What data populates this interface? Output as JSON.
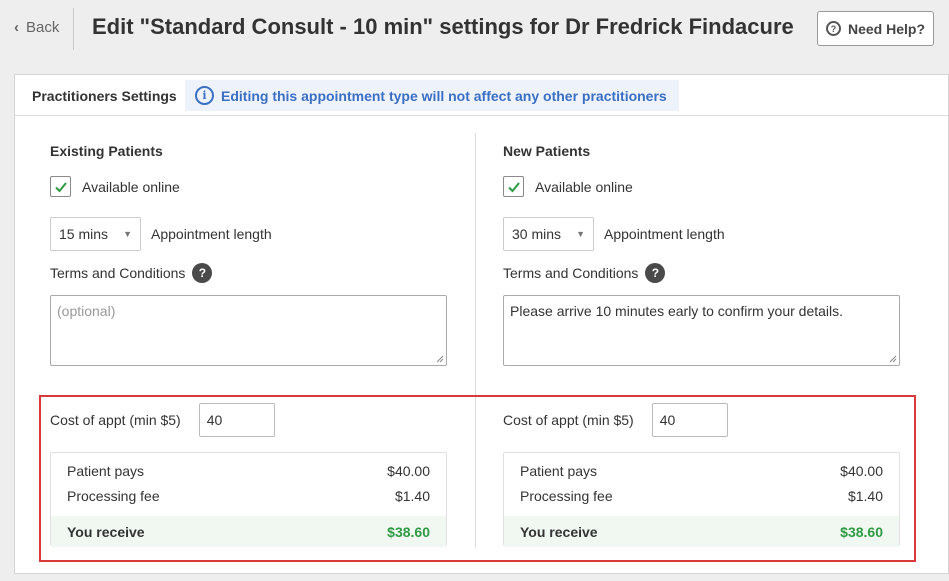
{
  "header": {
    "back_label": "Back",
    "title": "Edit \"Standard Consult - 10 min\" settings for Dr Fredrick Findacure",
    "help_label": "Need Help?"
  },
  "tabs": {
    "settings_label": "Practitioners Settings",
    "info_message": "Editing this appointment type will not affect any other practitioners"
  },
  "existing": {
    "heading": "Existing Patients",
    "available_online_label": "Available online",
    "available_online": true,
    "length_value": "15 mins",
    "length_label": "Appointment length",
    "terms_label": "Terms and Conditions",
    "terms_value": "",
    "terms_placeholder": "(optional)",
    "cost_label": "Cost of appt (min $5)",
    "cost_value": "40",
    "patient_pays_label": "Patient pays",
    "patient_pays": "$40.00",
    "processing_fee_label": "Processing fee",
    "processing_fee": "$1.40",
    "you_receive_label": "You receive",
    "you_receive": "$38.60"
  },
  "new": {
    "heading": "New Patients",
    "available_online_label": "Available online",
    "available_online": true,
    "length_value": "30 mins",
    "length_label": "Appointment length",
    "terms_label": "Terms and Conditions",
    "terms_value": "Please arrive 10 minutes early to confirm your details.",
    "cost_label": "Cost of appt (min $5)",
    "cost_value": "40",
    "patient_pays_label": "Patient pays",
    "patient_pays": "$40.00",
    "processing_fee_label": "Processing fee",
    "processing_fee": "$1.40",
    "you_receive_label": "You receive",
    "you_receive": "$38.60"
  },
  "colors": {
    "info_blue": "#3a6fc4",
    "check_green": "#2f9a44",
    "highlight_red": "#d93939",
    "receive_bg": "#f1f8f2"
  }
}
